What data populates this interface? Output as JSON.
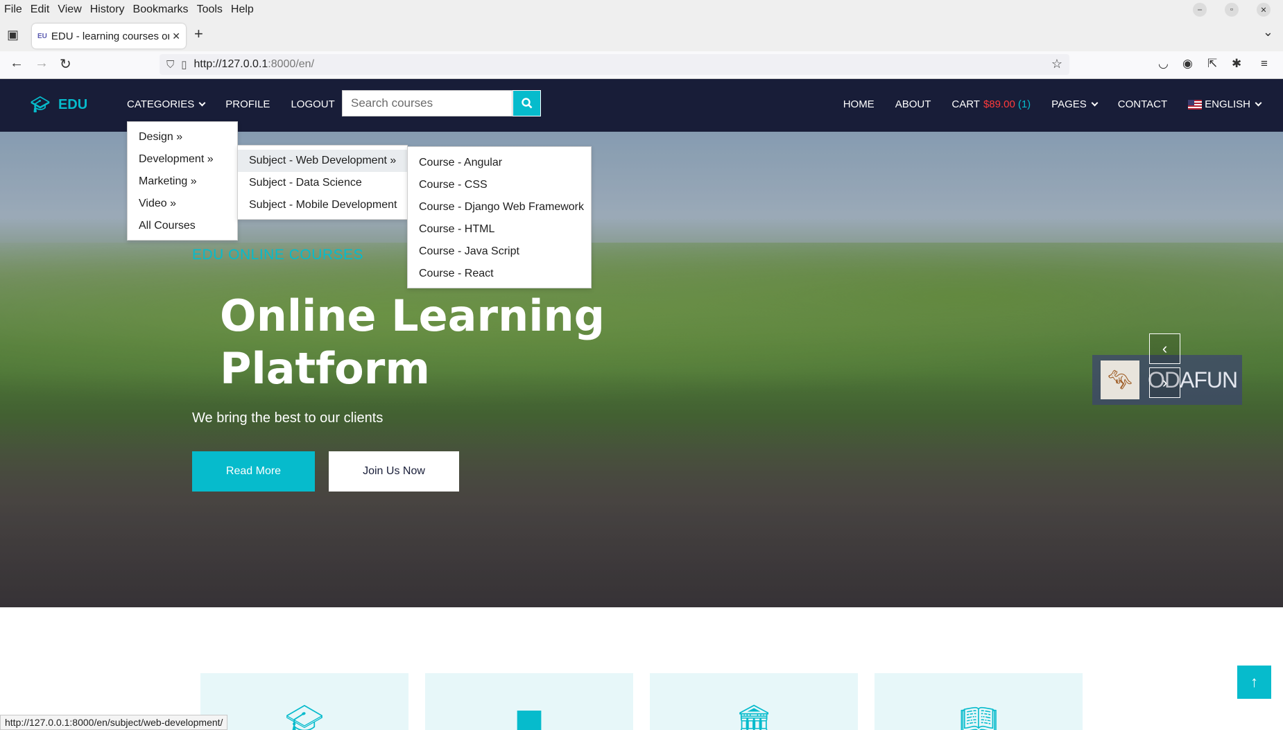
{
  "browser": {
    "menu": [
      "File",
      "Edit",
      "View",
      "History",
      "Bookmarks",
      "Tools",
      "Help"
    ],
    "tab_title": "EDU - learning courses or",
    "url_host": "http://127.0.0.1",
    "url_rest": ":8000/en/",
    "status_url": "http://127.0.0.1:8000/en/subject/web-development/"
  },
  "site": {
    "logo": "EDU",
    "nav": {
      "categories": "CATEGORIES",
      "profile": "PROFILE",
      "logout": "LOGOUT"
    },
    "search_placeholder": "Search courses",
    "right_nav": {
      "home": "HOME",
      "about": "ABOUT",
      "cart_label": "CART",
      "cart_amount": "$89.00",
      "cart_count": "(1)",
      "pages": "PAGES",
      "contact": "CONTACT",
      "language": "ENGLISH"
    }
  },
  "menus": {
    "categories": [
      "Design »",
      "Development »",
      "Marketing »",
      "Video »",
      "All Courses"
    ],
    "subjects": [
      "Subject - Web Development »",
      "Subject - Data Science",
      "Subject - Mobile Development"
    ],
    "courses": [
      "Course - Angular",
      "Course - CSS",
      "Course - Django Web Framework",
      "Course - HTML",
      "Course - Java Script",
      "Course - React"
    ]
  },
  "hero": {
    "subtitle": "EDU ONLINE COURSES",
    "title": "Online Learning Platform",
    "text": "We bring the best to our clients",
    "btn_read": "Read More",
    "btn_join": "Join Us Now",
    "watermark": "ODAFUN"
  },
  "colors": {
    "accent": "#06bbcc",
    "header_bg": "#181d38",
    "cart_price": "#ff3b3b"
  },
  "icons": [
    "graduation-cap-icon",
    "book-icon",
    "university-icon",
    "open-book-icon"
  ]
}
